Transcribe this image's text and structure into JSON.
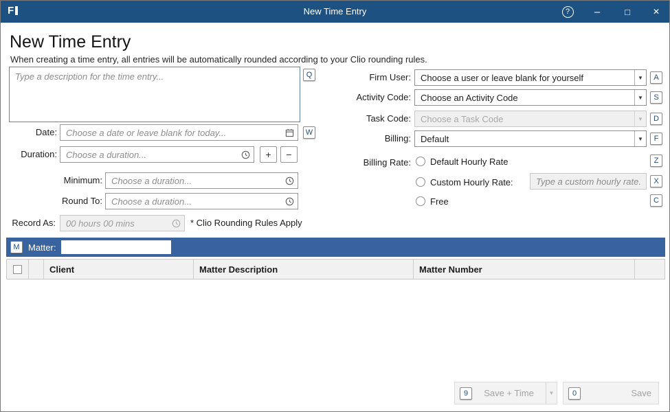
{
  "window": {
    "title": "New Time Entry",
    "app_icon_letter": "F",
    "controls": {
      "help_glyph": "?",
      "minimize_glyph": "–",
      "maximize_glyph": "□",
      "close_glyph": "✕"
    }
  },
  "header": {
    "title": "New Time Entry",
    "subtitle": "When creating a time entry, all entries will be automatically rounded according to your Clio rounding rules."
  },
  "icons": {
    "chevron_down": "▼",
    "plus": "+",
    "minus": "−"
  },
  "form": {
    "description": {
      "placeholder": "Type a description for the time entry...",
      "shortcut": "Q"
    },
    "date": {
      "label": "Date:",
      "placeholder": "Choose a date or leave blank for today...",
      "shortcut": "W"
    },
    "duration": {
      "label": "Duration:",
      "placeholder": "Choose a duration..."
    },
    "minimum": {
      "label": "Minimum:",
      "placeholder": "Choose a duration..."
    },
    "round_to": {
      "label": "Round To:",
      "placeholder": "Choose a duration..."
    },
    "record_as": {
      "label": "Record As:",
      "value": "00 hours 00 mins",
      "note": "* Clio Rounding Rules Apply"
    },
    "firm_user": {
      "label": "Firm User:",
      "value": "Choose a user or leave blank for yourself",
      "shortcut": "A"
    },
    "activity_code": {
      "label": "Activity Code:",
      "value": "Choose an Activity Code",
      "shortcut": "S"
    },
    "task_code": {
      "label": "Task Code:",
      "value": "Choose a Task Code",
      "shortcut": "D",
      "disabled": true
    },
    "billing": {
      "label": "Billing:",
      "value": "Default",
      "shortcut": "F"
    },
    "billing_rate": {
      "label": "Billing Rate:",
      "options": [
        {
          "label": "Default Hourly Rate",
          "shortcut": "Z",
          "selected": false
        },
        {
          "label": "Custom Hourly Rate:",
          "shortcut": "X",
          "selected": false,
          "placeholder": "Type a custom hourly rate."
        },
        {
          "label": "Free",
          "shortcut": "C",
          "selected": false
        }
      ]
    }
  },
  "matter": {
    "label": "Matter:",
    "shortcut": "M",
    "search_value": "",
    "table": {
      "columns": [
        "Client",
        "Matter Description",
        "Matter Number"
      ]
    }
  },
  "footer": {
    "save_plus_time": {
      "label": "Save + Time",
      "shortcut": "9"
    },
    "save": {
      "label": "Save",
      "shortcut": "0"
    }
  },
  "colors": {
    "titlebar": "#1d5182",
    "matter_bar": "#38639e",
    "shortcut_letter": "#1f4e79",
    "disabled_bg": "#f0f0f0"
  }
}
